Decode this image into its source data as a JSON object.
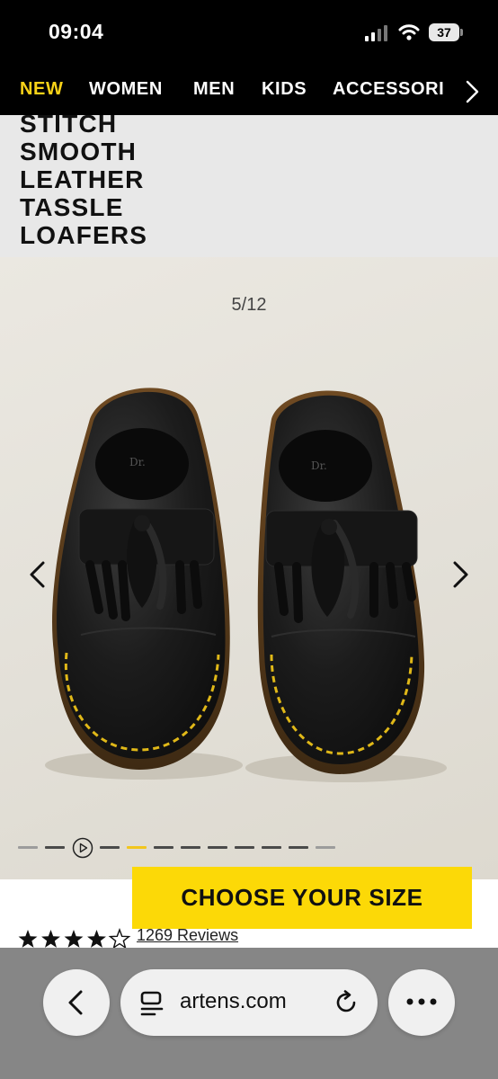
{
  "status": {
    "time": "09:04",
    "battery": "37"
  },
  "nav": {
    "items": [
      "NEW",
      "WOMEN",
      "MEN",
      "KIDS",
      "ACCESSORI"
    ],
    "active_color": "#f8d218"
  },
  "product": {
    "title_lines": [
      "STITCH",
      "SMOOTH",
      "LEATHER",
      "TASSLE",
      "LOAFERS"
    ]
  },
  "gallery": {
    "counter": "5/12",
    "current_index": 5,
    "total": 12
  },
  "cta": {
    "label": "CHOOSE YOUR SIZE",
    "color": "#fcd907"
  },
  "rating": {
    "stars": 4,
    "max": 5,
    "reviews_label": "1269 Reviews"
  },
  "browser": {
    "url": "artens.com"
  },
  "icons": {
    "signal": "signal-icon",
    "wifi": "wifi-icon",
    "battery": "battery-icon",
    "nav_more": "chevron-right-icon",
    "prev": "chevron-left-icon",
    "next": "chevron-right-icon",
    "play": "play-icon",
    "back": "back-icon",
    "reader": "reader-icon",
    "reload": "reload-icon",
    "more": "more-icon"
  }
}
